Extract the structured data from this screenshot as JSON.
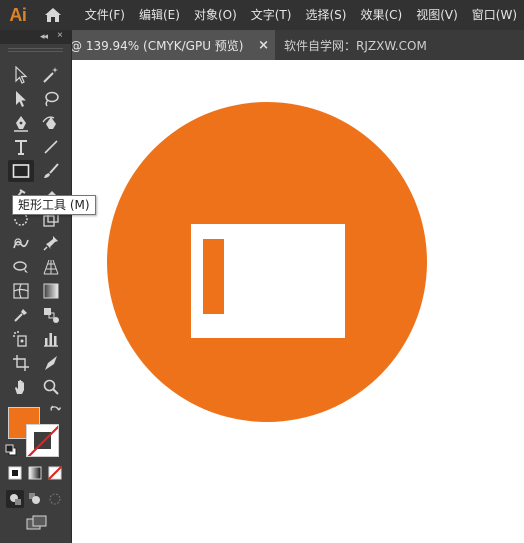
{
  "app": {
    "logo": "Ai"
  },
  "menu": [
    "文件(F)",
    "编辑(E)",
    "对象(O)",
    "文字(T)",
    "选择(S)",
    "效果(C)",
    "视图(V)",
    "窗口(W)"
  ],
  "tabs": {
    "active": "@ 139.94% (CMYK/GPU 预览)",
    "close": "×",
    "inactive": "软件自学网：RJZXW.COM"
  },
  "tooltip": "矩形工具 (M)",
  "toolbox": {
    "collapse": "◂◂",
    "close": "×"
  },
  "colors": {
    "fill": "#ee7219",
    "stroke": "none",
    "accent_orange": "#ee7219",
    "canvas": "#ffffff"
  },
  "tools": [
    "selection-tool",
    "magic-wand-tool",
    "direct-selection-tool",
    "lasso-tool",
    "pen-tool",
    "curvature-tool",
    "type-tool",
    "line-segment-tool",
    "rectangle-tool",
    "paintbrush-tool",
    "shaper-tool",
    "eraser-tool",
    "rotate-tool",
    "scale-tool",
    "warp-tool",
    "free-transform-tool",
    "shape-builder-tool",
    "puppet-warp-tool",
    "perspective-grid-tool",
    "mesh-tool",
    "gradient-tool",
    "eyedropper-tool",
    "blend-tool",
    "symbol-sprayer-tool",
    "column-graph-tool",
    "artboard-tool",
    "slice-tool",
    "hand-tool",
    "zoom-tool"
  ]
}
